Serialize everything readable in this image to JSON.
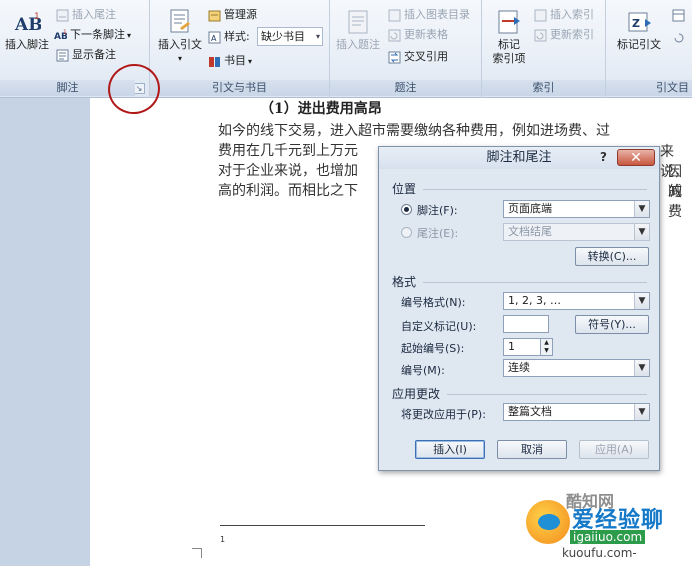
{
  "ribbon": {
    "groups": {
      "footnotes": "脚注",
      "citations": "引文与书目",
      "captions": "题注",
      "index": "索引",
      "toa": "引文目"
    },
    "footnotes": {
      "insert_footnote": "插入脚注",
      "insert_endnote": "插入尾注",
      "next_footnote": "下一条脚注",
      "show_notes": "显示备注"
    },
    "citations": {
      "insert_citation": "插入引文",
      "manage_sources": "管理源",
      "style_label": "样式:",
      "style_value": "缺少书目",
      "bibliography": "书目"
    },
    "captions": {
      "insert_caption": "插入题注",
      "insert_table_of_figures": "插入图表目录",
      "update_table": "更新表格",
      "cross_reference": "交叉引用"
    },
    "index": {
      "mark_entry_line1": "标记",
      "mark_entry_line2": "索引项",
      "insert_index": "插入索引",
      "update_index": "更新索引"
    },
    "toa": {
      "mark_citation": "标记引文"
    }
  },
  "document": {
    "heading_fragment": "（1）进出费用高昂",
    "lines": [
      "如今的线下交易，进入超市需要缴纳各种费用，例如进场费、过",
      "费用在几千元到上万元",
      "对于企业来说，也增加",
      "高的利润。而相比之下"
    ],
    "right_fragments": [
      "来说，",
      "因减",
      "的费"
    ],
    "footnote_number": "1"
  },
  "dialog": {
    "title": "脚注和尾注",
    "help": "?",
    "close": "✕",
    "location": {
      "section": "位置",
      "footnote_label": "脚注(F):",
      "footnote_value": "页面底端",
      "endnote_label": "尾注(E):",
      "endnote_value": "文档结尾",
      "convert_button": "转换(C)..."
    },
    "format": {
      "section": "格式",
      "number_format_label": "编号格式(N):",
      "number_format_value": "1, 2, 3, …",
      "custom_mark_label": "自定义标记(U):",
      "custom_mark_value": "",
      "symbol_button": "符号(Y)...",
      "start_at_label": "起始编号(S):",
      "start_at_value": "1",
      "numbering_label": "编号(M):",
      "numbering_value": "连续"
    },
    "apply": {
      "section": "应用更改",
      "apply_to_label": "将更改应用于(P):",
      "apply_to_value": "整篇文档"
    },
    "buttons": {
      "insert": "插入(I)",
      "cancel": "取消",
      "apply": "应用(A)"
    }
  },
  "watermark": {
    "top": "酷知网",
    "brand": "爱经验聊",
    "url": "igaiiuo.com",
    "url2": "kuoufu.com-"
  },
  "colors": {
    "accent_blue": "#1479c8",
    "annotation_red": "#b01818",
    "close_red": "#c8563f"
  }
}
